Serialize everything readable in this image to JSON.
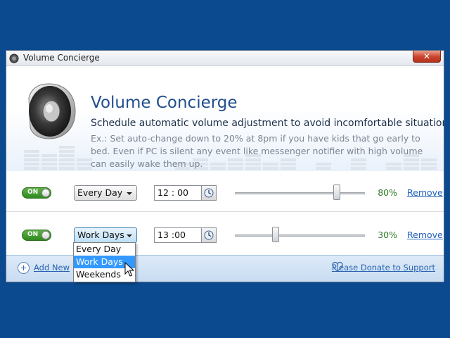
{
  "window": {
    "title": "Volume Concierge",
    "close_label": "✕"
  },
  "header": {
    "title": "Volume Concierge",
    "subtitle": "Schedule automatic volume adjustment to avoid incomfortable situations",
    "description": "Ex.: Set auto-change down to 20% at 8pm if you have kids that go early to bed. Even if PC is silent any event like messenger notifier with high volume can easily wake them up."
  },
  "schedules": [
    {
      "enabled_label": "ON",
      "day": "Every Day",
      "time": "12 : 00",
      "volume": 80,
      "volume_label": "80%",
      "remove_label": "Remove"
    },
    {
      "enabled_label": "ON",
      "day": "Work Days",
      "time": "13 :00",
      "volume": 30,
      "volume_label": "30%",
      "remove_label": "Remove"
    }
  ],
  "dropdown": {
    "options": [
      "Every Day",
      "Work Days",
      "Weekends"
    ],
    "highlighted": "Work Days"
  },
  "footer": {
    "add_label": "Add New",
    "donate_label": "Please Donate to Support"
  },
  "colors": {
    "background": "#0b4a8f",
    "accent": "#1f4e8c",
    "toggle_on": "#2f8a1e",
    "link": "#1f5fbf",
    "highlight": "#3399ff"
  },
  "icons": [
    "speaker-icon",
    "clock-icon",
    "add-icon",
    "heart-icon",
    "close-icon",
    "chevron-down-icon",
    "mouse-cursor-icon"
  ]
}
